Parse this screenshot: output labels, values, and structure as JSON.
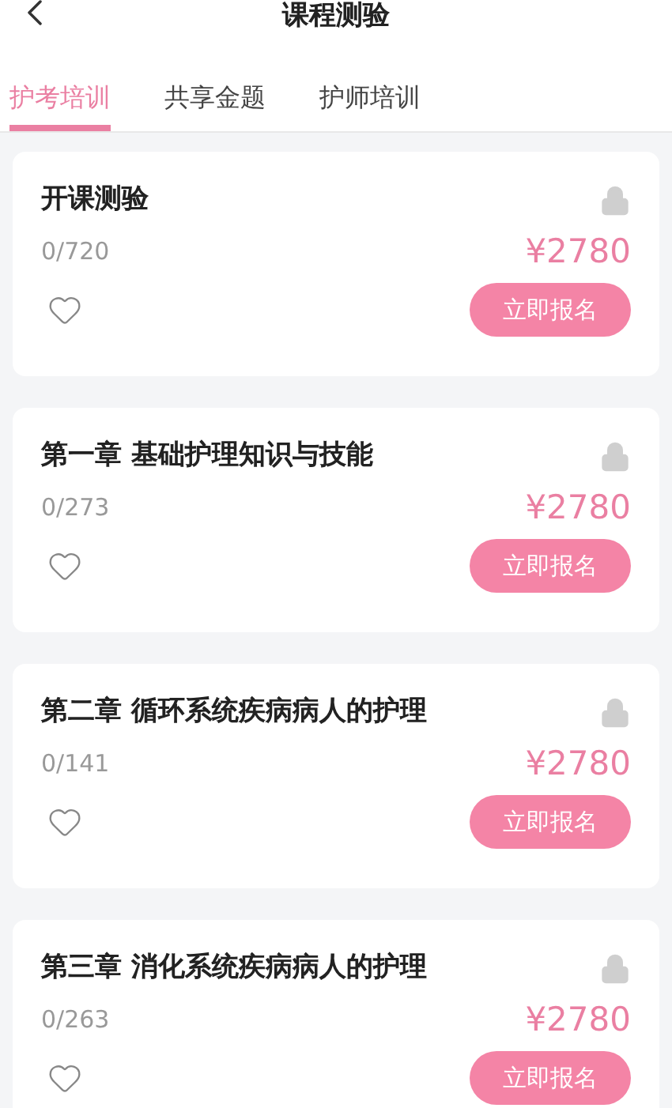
{
  "header": {
    "title": "课程测验"
  },
  "tabs": [
    {
      "label": "护考培训",
      "selected": true
    },
    {
      "label": "共享金题",
      "selected": false
    },
    {
      "label": "护师培训",
      "selected": false
    }
  ],
  "courses": [
    {
      "title": "开课测验",
      "progress": "0/720",
      "price": "¥2780",
      "locked": true,
      "favorite": false,
      "button": "立即报名"
    },
    {
      "title": "第一章 基础护理知识与技能",
      "progress": "0/273",
      "price": "¥2780",
      "locked": true,
      "favorite": false,
      "button": "立即报名"
    },
    {
      "title": "第二章 循环系统疾病病人的护理",
      "progress": "0/141",
      "price": "¥2780",
      "locked": true,
      "favorite": false,
      "button": "立即报名"
    },
    {
      "title": "第三章 消化系统疾病病人的护理",
      "progress": "0/263",
      "price": "¥2780",
      "locked": true,
      "favorite": false,
      "button": "立即报名"
    }
  ]
}
